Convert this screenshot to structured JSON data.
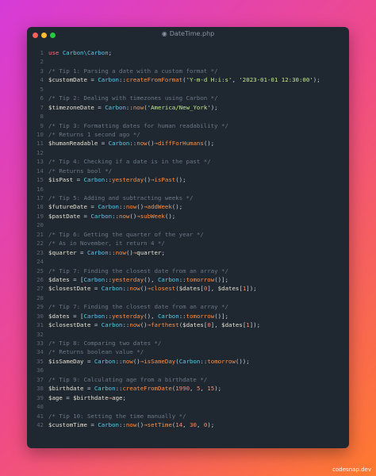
{
  "window": {
    "title": "DateTime.php",
    "file_icon": "php-file-icon"
  },
  "watermark": "codesnap.dev",
  "colors": {
    "background_gradient": [
      "#d63bd8",
      "#ef4b88",
      "#ff7a2e"
    ],
    "editor_bg": "#1f2731",
    "close": "#ff5f57",
    "minimize": "#febc2e",
    "maximize": "#28c840"
  },
  "code_lines": [
    {
      "n": "1",
      "tokens": [
        [
          "kw",
          "use"
        ],
        [
          "pun",
          " "
        ],
        [
          "cls",
          "Carbon\\Carbon"
        ],
        [
          "pun",
          ";"
        ]
      ]
    },
    {
      "n": "2",
      "tokens": []
    },
    {
      "n": "3",
      "tokens": [
        [
          "com",
          "/* Tip 1: Parsing a date with a custom format */"
        ]
      ]
    },
    {
      "n": "4",
      "tokens": [
        [
          "var",
          "$customDate"
        ],
        [
          "pun",
          " = "
        ],
        [
          "cls",
          "Carbon"
        ],
        [
          "pun",
          "::"
        ],
        [
          "fn",
          "createFromFormat"
        ],
        [
          "pun",
          "("
        ],
        [
          "str",
          "'Y-m-d H:i:s'"
        ],
        [
          "pun",
          ", "
        ],
        [
          "str",
          "'2023-01-01 12:30:00'"
        ],
        [
          "pun",
          ");"
        ]
      ]
    },
    {
      "n": "5",
      "tokens": []
    },
    {
      "n": "6",
      "tokens": [
        [
          "com",
          "/* Tip 2: Dealing with timezones using Carbon */"
        ]
      ]
    },
    {
      "n": "7",
      "tokens": [
        [
          "var",
          "$timezoneDate"
        ],
        [
          "pun",
          " = "
        ],
        [
          "cls",
          "Carbon"
        ],
        [
          "pun",
          "::"
        ],
        [
          "fn",
          "now"
        ],
        [
          "pun",
          "("
        ],
        [
          "str",
          "'America/New_York'"
        ],
        [
          "pun",
          ");"
        ]
      ]
    },
    {
      "n": "8",
      "tokens": []
    },
    {
      "n": "9",
      "tokens": [
        [
          "com",
          "/* Tip 3: Formatting dates for human readability */"
        ]
      ]
    },
    {
      "n": "10",
      "tokens": [
        [
          "com",
          "/* Returns 1 second ago */"
        ]
      ]
    },
    {
      "n": "11",
      "tokens": [
        [
          "var",
          "$humanReadable"
        ],
        [
          "pun",
          " = "
        ],
        [
          "cls",
          "Carbon"
        ],
        [
          "pun",
          "::"
        ],
        [
          "fn",
          "now"
        ],
        [
          "pun",
          "()"
        ],
        [
          "op",
          "→"
        ],
        [
          "fn",
          "diffForHumans"
        ],
        [
          "pun",
          "();"
        ]
      ]
    },
    {
      "n": "12",
      "tokens": []
    },
    {
      "n": "13",
      "tokens": [
        [
          "com",
          "/* Tip 4: Checking if a date is in the past */"
        ]
      ]
    },
    {
      "n": "14",
      "tokens": [
        [
          "com",
          "/* Returns bool */"
        ]
      ]
    },
    {
      "n": "15",
      "tokens": [
        [
          "var",
          "$isPast"
        ],
        [
          "pun",
          " = "
        ],
        [
          "cls",
          "Carbon"
        ],
        [
          "pun",
          "::"
        ],
        [
          "fn",
          "yesterday"
        ],
        [
          "pun",
          "()"
        ],
        [
          "op",
          "→"
        ],
        [
          "fn",
          "isPast"
        ],
        [
          "pun",
          "();"
        ]
      ]
    },
    {
      "n": "16",
      "tokens": []
    },
    {
      "n": "17",
      "tokens": [
        [
          "com",
          "/* Tip 5: Adding and subtracting weeks */"
        ]
      ]
    },
    {
      "n": "18",
      "tokens": [
        [
          "var",
          "$futureDate"
        ],
        [
          "pun",
          " = "
        ],
        [
          "cls",
          "Carbon"
        ],
        [
          "pun",
          "::"
        ],
        [
          "fn",
          "now"
        ],
        [
          "pun",
          "()"
        ],
        [
          "op",
          "→"
        ],
        [
          "fn",
          "addWeek"
        ],
        [
          "pun",
          "();"
        ]
      ]
    },
    {
      "n": "19",
      "tokens": [
        [
          "var",
          "$pastDate"
        ],
        [
          "pun",
          " = "
        ],
        [
          "cls",
          "Carbon"
        ],
        [
          "pun",
          "::"
        ],
        [
          "fn",
          "now"
        ],
        [
          "pun",
          "()"
        ],
        [
          "op",
          "→"
        ],
        [
          "fn",
          "subWeek"
        ],
        [
          "pun",
          "();"
        ]
      ]
    },
    {
      "n": "20",
      "tokens": []
    },
    {
      "n": "21",
      "tokens": [
        [
          "com",
          "/* Tip 6: Getting the quarter of the year */"
        ]
      ]
    },
    {
      "n": "22",
      "tokens": [
        [
          "com",
          "/* As in November, it return 4 */"
        ]
      ]
    },
    {
      "n": "23",
      "tokens": [
        [
          "var",
          "$quarter"
        ],
        [
          "pun",
          " = "
        ],
        [
          "cls",
          "Carbon"
        ],
        [
          "pun",
          "::"
        ],
        [
          "fn",
          "now"
        ],
        [
          "pun",
          "()"
        ],
        [
          "op",
          "→"
        ],
        [
          "var",
          "quarter"
        ],
        [
          "pun",
          ";"
        ]
      ]
    },
    {
      "n": "24",
      "tokens": []
    },
    {
      "n": "25",
      "tokens": [
        [
          "com",
          "/* Tip 7: Finding the closest date from an array */"
        ]
      ]
    },
    {
      "n": "26",
      "tokens": [
        [
          "var",
          "$dates"
        ],
        [
          "pun",
          " = ["
        ],
        [
          "cls",
          "Carbon"
        ],
        [
          "pun",
          "::"
        ],
        [
          "fn",
          "yesterday"
        ],
        [
          "pun",
          "(), "
        ],
        [
          "cls",
          "Carbon"
        ],
        [
          "pun",
          "::"
        ],
        [
          "fn",
          "tomorrow"
        ],
        [
          "pun",
          "()];"
        ]
      ]
    },
    {
      "n": "27",
      "tokens": [
        [
          "var",
          "$closestDate"
        ],
        [
          "pun",
          " = "
        ],
        [
          "cls",
          "Carbon"
        ],
        [
          "pun",
          "::"
        ],
        [
          "fn",
          "now"
        ],
        [
          "pun",
          "()"
        ],
        [
          "op",
          "→"
        ],
        [
          "fn",
          "closest"
        ],
        [
          "pun",
          "("
        ],
        [
          "var",
          "$dates"
        ],
        [
          "pun",
          "["
        ],
        [
          "num",
          "0"
        ],
        [
          "pun",
          "], "
        ],
        [
          "var",
          "$dates"
        ],
        [
          "pun",
          "["
        ],
        [
          "num",
          "1"
        ],
        [
          "pun",
          "]);"
        ]
      ]
    },
    {
      "n": "28",
      "tokens": []
    },
    {
      "n": "29",
      "tokens": [
        [
          "com",
          "/* Tip 7: Finding the closest date from an array */"
        ]
      ]
    },
    {
      "n": "30",
      "tokens": [
        [
          "var",
          "$dates"
        ],
        [
          "pun",
          " = ["
        ],
        [
          "cls",
          "Carbon"
        ],
        [
          "pun",
          "::"
        ],
        [
          "fn",
          "yesterday"
        ],
        [
          "pun",
          "(), "
        ],
        [
          "cls",
          "Carbon"
        ],
        [
          "pun",
          "::"
        ],
        [
          "fn",
          "tomorrow"
        ],
        [
          "pun",
          "()];"
        ]
      ]
    },
    {
      "n": "31",
      "tokens": [
        [
          "var",
          "$closestDate"
        ],
        [
          "pun",
          " = "
        ],
        [
          "cls",
          "Carbon"
        ],
        [
          "pun",
          "::"
        ],
        [
          "fn",
          "now"
        ],
        [
          "pun",
          "()"
        ],
        [
          "op",
          "→"
        ],
        [
          "fn",
          "farthest"
        ],
        [
          "pun",
          "("
        ],
        [
          "var",
          "$dates"
        ],
        [
          "pun",
          "["
        ],
        [
          "num",
          "0"
        ],
        [
          "pun",
          "], "
        ],
        [
          "var",
          "$dates"
        ],
        [
          "pun",
          "["
        ],
        [
          "num",
          "1"
        ],
        [
          "pun",
          "]);"
        ]
      ]
    },
    {
      "n": "32",
      "tokens": []
    },
    {
      "n": "33",
      "tokens": [
        [
          "com",
          "/* Tip 8: Comparing two dates */"
        ]
      ]
    },
    {
      "n": "34",
      "tokens": [
        [
          "com",
          "/* Returns boolean value */"
        ]
      ]
    },
    {
      "n": "35",
      "tokens": [
        [
          "var",
          "$isSameDay"
        ],
        [
          "pun",
          " = "
        ],
        [
          "cls",
          "Carbon"
        ],
        [
          "pun",
          "::"
        ],
        [
          "fn",
          "now"
        ],
        [
          "pun",
          "()"
        ],
        [
          "op",
          "→"
        ],
        [
          "fn",
          "isSameDay"
        ],
        [
          "pun",
          "("
        ],
        [
          "cls",
          "Carbon"
        ],
        [
          "pun",
          "::"
        ],
        [
          "fn",
          "tomorrow"
        ],
        [
          "pun",
          "());"
        ]
      ]
    },
    {
      "n": "36",
      "tokens": []
    },
    {
      "n": "37",
      "tokens": [
        [
          "com",
          "/* Tip 9: Calculating age from a birthdate */"
        ]
      ]
    },
    {
      "n": "38",
      "tokens": [
        [
          "var",
          "$birthdate"
        ],
        [
          "pun",
          " = "
        ],
        [
          "cls",
          "Carbon"
        ],
        [
          "pun",
          "::"
        ],
        [
          "fn",
          "createFromDate"
        ],
        [
          "pun",
          "("
        ],
        [
          "num",
          "1990"
        ],
        [
          "pun",
          ", "
        ],
        [
          "num",
          "5"
        ],
        [
          "pun",
          ", "
        ],
        [
          "num",
          "15"
        ],
        [
          "pun",
          ");"
        ]
      ]
    },
    {
      "n": "39",
      "tokens": [
        [
          "var",
          "$age"
        ],
        [
          "pun",
          " = "
        ],
        [
          "var",
          "$birthdate"
        ],
        [
          "op",
          "→"
        ],
        [
          "var",
          "age"
        ],
        [
          "pun",
          ";"
        ]
      ]
    },
    {
      "n": "40",
      "tokens": []
    },
    {
      "n": "41",
      "tokens": [
        [
          "com",
          "/* Tip 10: Setting the time manually */"
        ]
      ]
    },
    {
      "n": "42",
      "tokens": [
        [
          "var",
          "$customTime"
        ],
        [
          "pun",
          " = "
        ],
        [
          "cls",
          "Carbon"
        ],
        [
          "pun",
          "::"
        ],
        [
          "fn",
          "now"
        ],
        [
          "pun",
          "()"
        ],
        [
          "op",
          "→"
        ],
        [
          "fn",
          "setTime"
        ],
        [
          "pun",
          "("
        ],
        [
          "num",
          "14"
        ],
        [
          "pun",
          ", "
        ],
        [
          "num",
          "30"
        ],
        [
          "pun",
          ", "
        ],
        [
          "num",
          "0"
        ],
        [
          "pun",
          ");"
        ]
      ]
    }
  ]
}
